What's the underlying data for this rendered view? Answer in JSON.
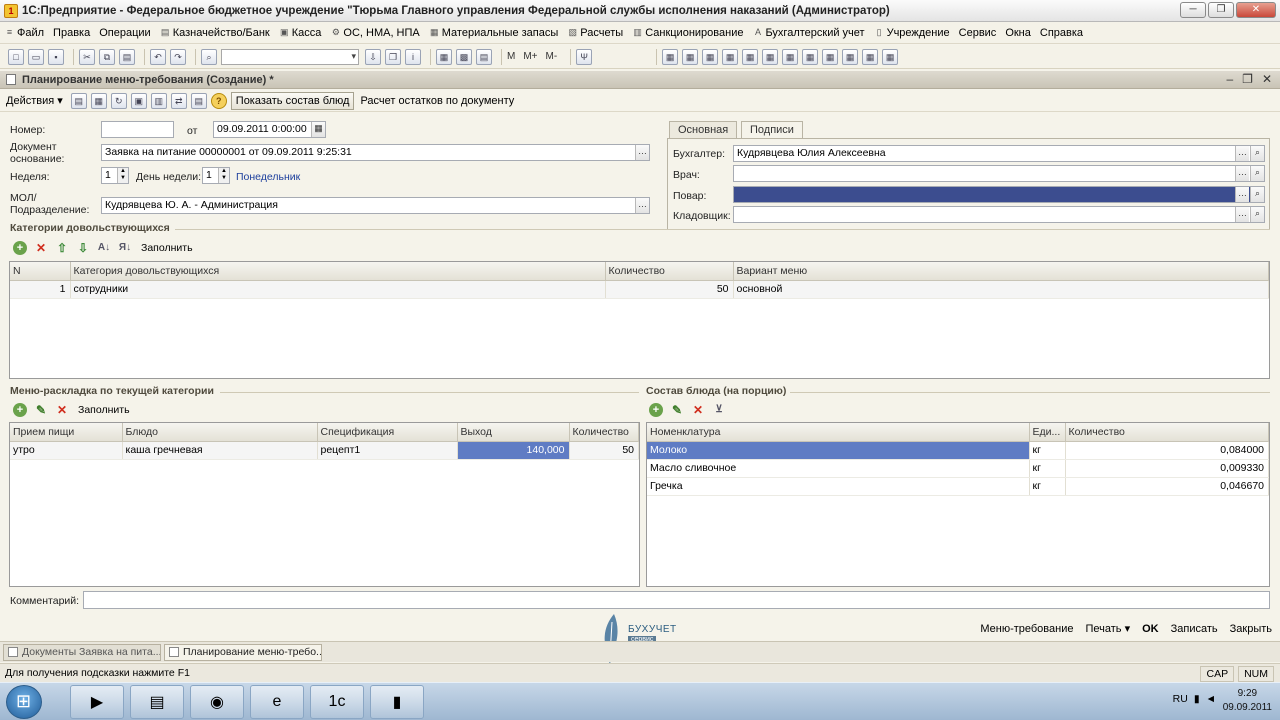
{
  "window": {
    "title": "1С:Предприятие - Федеральное бюджетное учреждение \"Тюрьма Главного управления Федеральной службы исполнения наказаний (Администратор)"
  },
  "menu": [
    "Файл",
    "Правка",
    "Операции",
    "Казначейство/Банк",
    "Касса",
    "ОС, НМА, НПА",
    "Материальные запасы",
    "Расчеты",
    "Санкционирование",
    "Бухгалтерский учет",
    "Учреждение",
    "Сервис",
    "Окна",
    "Справка"
  ],
  "toolbar": {
    "m_labels": [
      "M",
      "M+",
      "M-"
    ]
  },
  "doc": {
    "title": "Планирование меню-требования (Создание) *",
    "actions_label": "Действия ▾",
    "show_button": "Показать состав блюд",
    "calc_label": "Расчет остатков по документу"
  },
  "form": {
    "number_label": "Номер:",
    "number_value": "",
    "from_label": "от",
    "date_value": "09.09.2011 0:00:00",
    "basis_label": "Документ основание:",
    "basis_value": "Заявка на питание 00000001 от 09.09.2011 9:25:31",
    "week_label": "Неделя:",
    "week_value": "1",
    "weekday_label": "День недели:",
    "weekday_value": "1",
    "weekday_name": "Понедельник",
    "mol_label": "МОЛ/ Подразделение:",
    "mol_value": "Кудрявцева Ю. А. - Администрация"
  },
  "tabs": {
    "items": [
      "Основная",
      "Подписи"
    ],
    "active": "Подписи",
    "fields": [
      {
        "label": "Бухгалтер:",
        "value": "Кудрявцева Юлия Алексеевна"
      },
      {
        "label": "Врач:",
        "value": ""
      },
      {
        "label": "Повар:",
        "value": ""
      },
      {
        "label": "Кладовщик:",
        "value": ""
      }
    ]
  },
  "categories": {
    "title": "Категории довольствующихся",
    "fill_label": "Заполнить",
    "columns": [
      "N",
      "Категория довольствующихся",
      "Количество",
      "Вариант меню"
    ],
    "rows": [
      {
        "n": "1",
        "category": "сотрудники",
        "qty": "50",
        "variant": "основной"
      }
    ]
  },
  "menu_table": {
    "title": "Меню-раскладка по текущей категории",
    "fill_label": "Заполнить",
    "columns": [
      "Прием пищи",
      "Блюдо",
      "Спецификация",
      "Выход",
      "Количество"
    ],
    "rows": [
      {
        "meal": "утро",
        "dish": "каша гречневая",
        "spec": "рецепт1",
        "output": "140,000",
        "qty": "50"
      }
    ]
  },
  "composition": {
    "title": "Состав блюда (на порцию)",
    "columns": [
      "Номенклатура",
      "Еди...",
      "Количество"
    ],
    "rows": [
      {
        "item": "Молоко",
        "unit": "кг",
        "qty": "0,084000"
      },
      {
        "item": "Масло сливочное",
        "unit": "кг",
        "qty": "0,009330"
      },
      {
        "item": "Гречка",
        "unit": "кг",
        "qty": "0,046670"
      }
    ]
  },
  "comment_label": "Комментарий:",
  "logo": {
    "name": "БУХУЧЕТ",
    "sub": "сервис"
  },
  "bottom": {
    "menu_req": "Меню-требование",
    "print": "Печать ▾",
    "ok": "OK",
    "save": "Записать",
    "close": "Закрыть"
  },
  "window_tabs": [
    "Документы Заявка на пита...",
    "Планирование меню-требо..."
  ],
  "status": {
    "hint": "Для получения подсказки нажмите F1",
    "cap": "CAP",
    "num": "NUM"
  },
  "taskbar": {
    "lang": "RU",
    "time": "9:29",
    "date": "09.09.2011"
  }
}
